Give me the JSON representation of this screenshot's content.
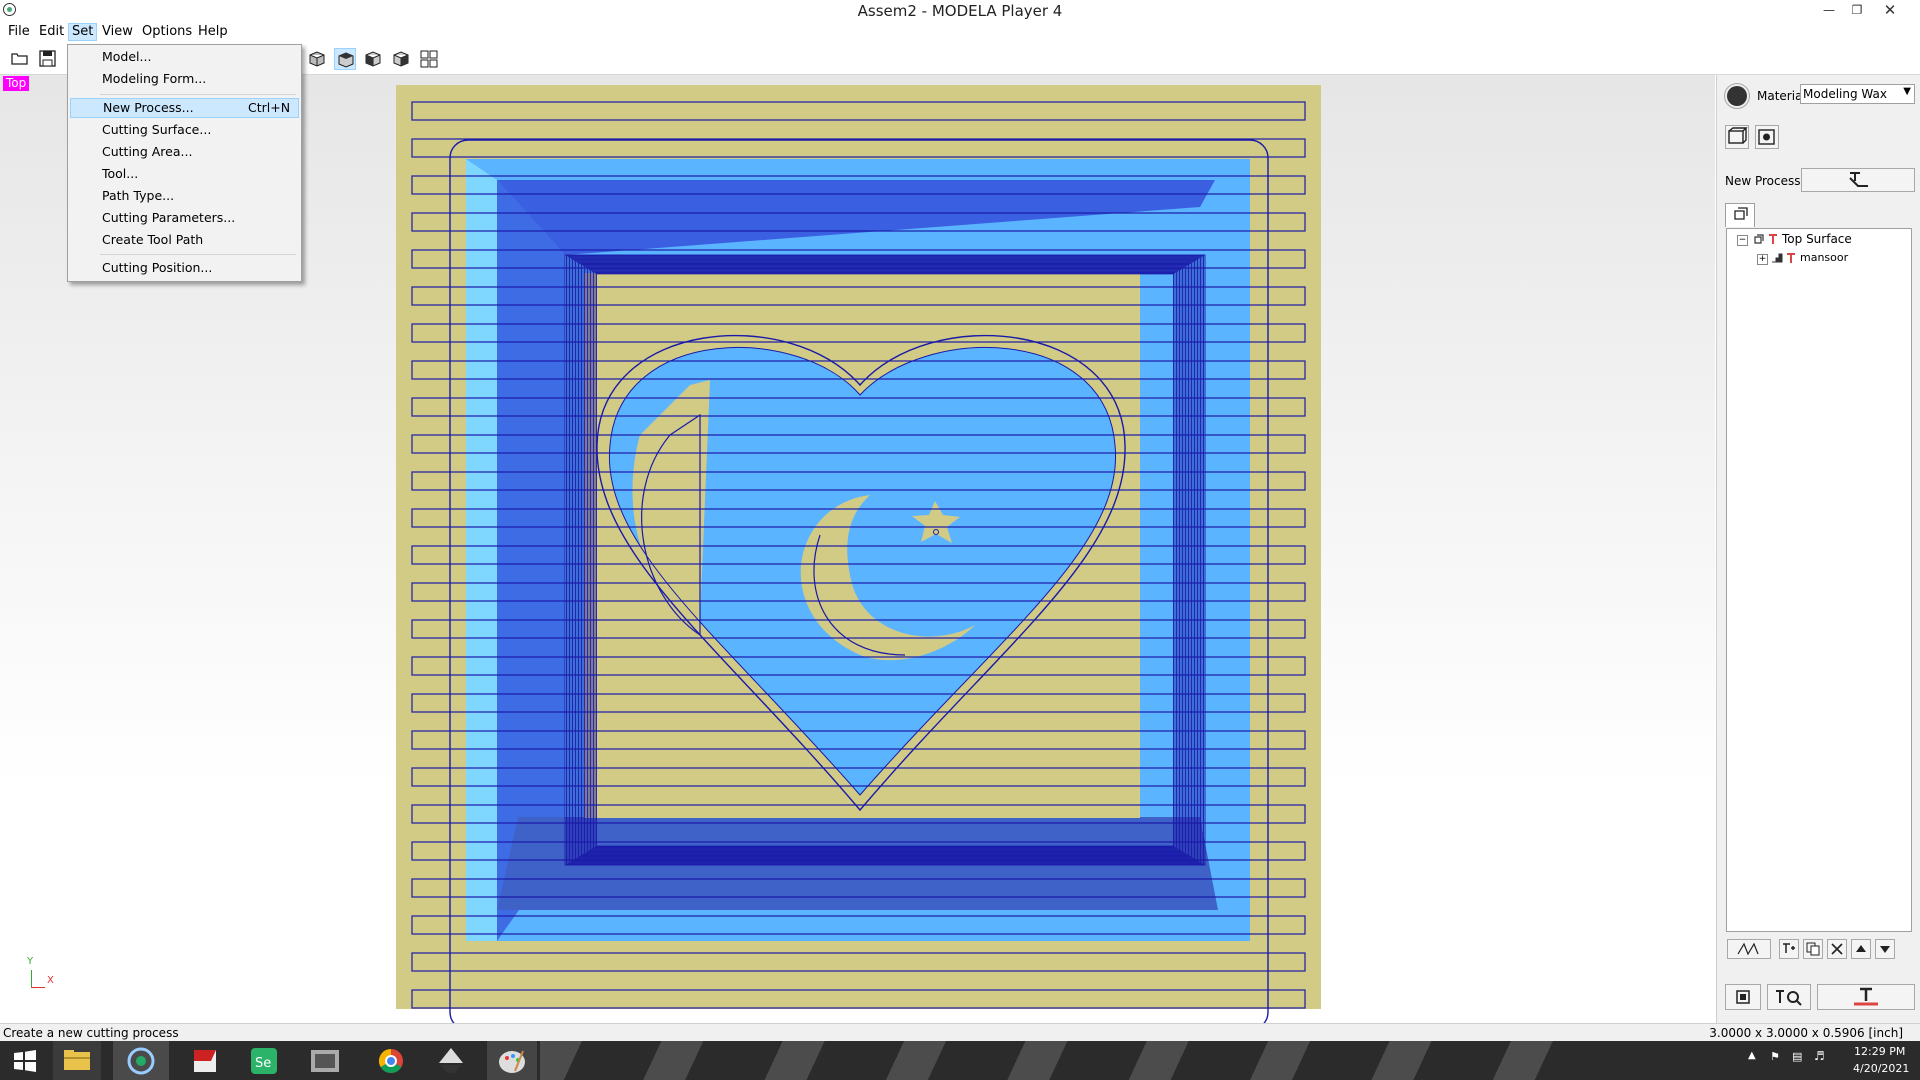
{
  "window": {
    "title": "Assem2 - MODELA Player 4"
  },
  "menubar": {
    "items": [
      "File",
      "Edit",
      "Set",
      "View",
      "Options",
      "Help"
    ],
    "active": "Set"
  },
  "set_menu": {
    "items": [
      {
        "label": "Model...",
        "shortcut": ""
      },
      {
        "label": "Modeling Form...",
        "shortcut": ""
      },
      {
        "label": "New Process...",
        "shortcut": "Ctrl+N"
      },
      {
        "label": "Cutting Surface...",
        "shortcut": ""
      },
      {
        "label": "Cutting Area...",
        "shortcut": ""
      },
      {
        "label": "Tool...",
        "shortcut": ""
      },
      {
        "label": "Path Type...",
        "shortcut": ""
      },
      {
        "label": "Cutting Parameters...",
        "shortcut": ""
      },
      {
        "label": "Create Tool Path",
        "shortcut": ""
      },
      {
        "label": "Cutting Position...",
        "shortcut": ""
      }
    ]
  },
  "viewport": {
    "view_label": "Top",
    "axis_y": "Y",
    "axis_x": "X"
  },
  "panel": {
    "material_label": "Material",
    "material_value": "Modeling Wax",
    "new_process_label": "New Process",
    "tree": {
      "root": "Top Surface",
      "child": "mansoor"
    }
  },
  "status": {
    "message": "Create a new cutting process",
    "dimensions": "3.0000 x 3.0000 x 0.5906 [inch]"
  },
  "taskbar": {
    "time": "12:29 PM",
    "date": "4/20/2021"
  },
  "colors": {
    "wax": "#d2cb86",
    "cut_blue": "#5ab4ff",
    "deep_blue": "#3a5fe0",
    "path_line": "#1a1aa8",
    "highlight": "#cce8ff",
    "view_label_bg": "#ff00ff"
  }
}
